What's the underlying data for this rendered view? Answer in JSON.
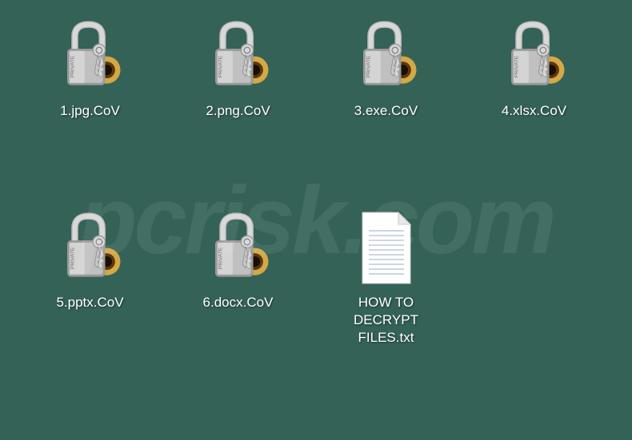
{
  "files": [
    {
      "name": "1.jpg.CoV",
      "icon_type": "lock"
    },
    {
      "name": "2.png.CoV",
      "icon_type": "lock"
    },
    {
      "name": "3.exe.CoV",
      "icon_type": "lock"
    },
    {
      "name": "4.xlsx.CoV",
      "icon_type": "lock"
    },
    {
      "name": "5.pptx.CoV",
      "icon_type": "lock"
    },
    {
      "name": "6.docx.CoV",
      "icon_type": "lock"
    },
    {
      "name": "HOW TO DECRYPT FILES.txt",
      "icon_type": "txt"
    }
  ],
  "watermark": "pcrisk.com"
}
